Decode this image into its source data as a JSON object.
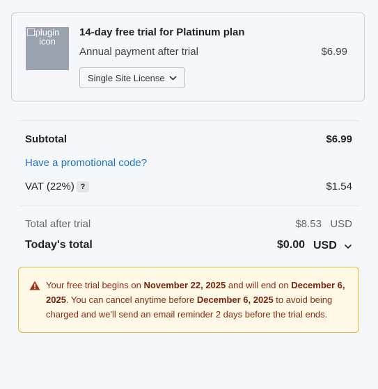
{
  "plan": {
    "image_alt": "plugin icon",
    "title": "14-day free trial for Platinum plan",
    "subtitle": "Annual payment after trial",
    "price": "$6.99",
    "license_selected": "Single Site License"
  },
  "summary": {
    "subtotal_label": "Subtotal",
    "subtotal_value": "$6.99",
    "promo_link": "Have a promotional code?",
    "vat_label": "VAT (22%)",
    "vat_help": "?",
    "vat_value": "$1.54",
    "after_trial_label": "Total after trial",
    "after_trial_value": "$8.53",
    "after_trial_currency": "USD",
    "today_label": "Today's total",
    "today_value": "$0.00",
    "today_currency": "USD"
  },
  "notice": {
    "t1": "Your free trial begins on ",
    "d1": "November 22, 2025",
    "t2": " and will end on ",
    "d2": "December 6, 2025",
    "t3": ". You can cancel anytime before ",
    "d3": "December 6, 2025",
    "t4": " to avoid being charged and we'll send an email reminder 2 days before the trial ends."
  },
  "colors": {
    "link": "#1a73c8",
    "notice_bg": "#fef8e7",
    "notice_border": "#e8b53f",
    "notice_text": "#8a2c0d",
    "warning_icon": "#a0360f"
  },
  "icons": {
    "license_dropdown": "chevron-down-icon",
    "currency_dropdown": "chevron-down-icon",
    "notice": "warning-icon"
  }
}
